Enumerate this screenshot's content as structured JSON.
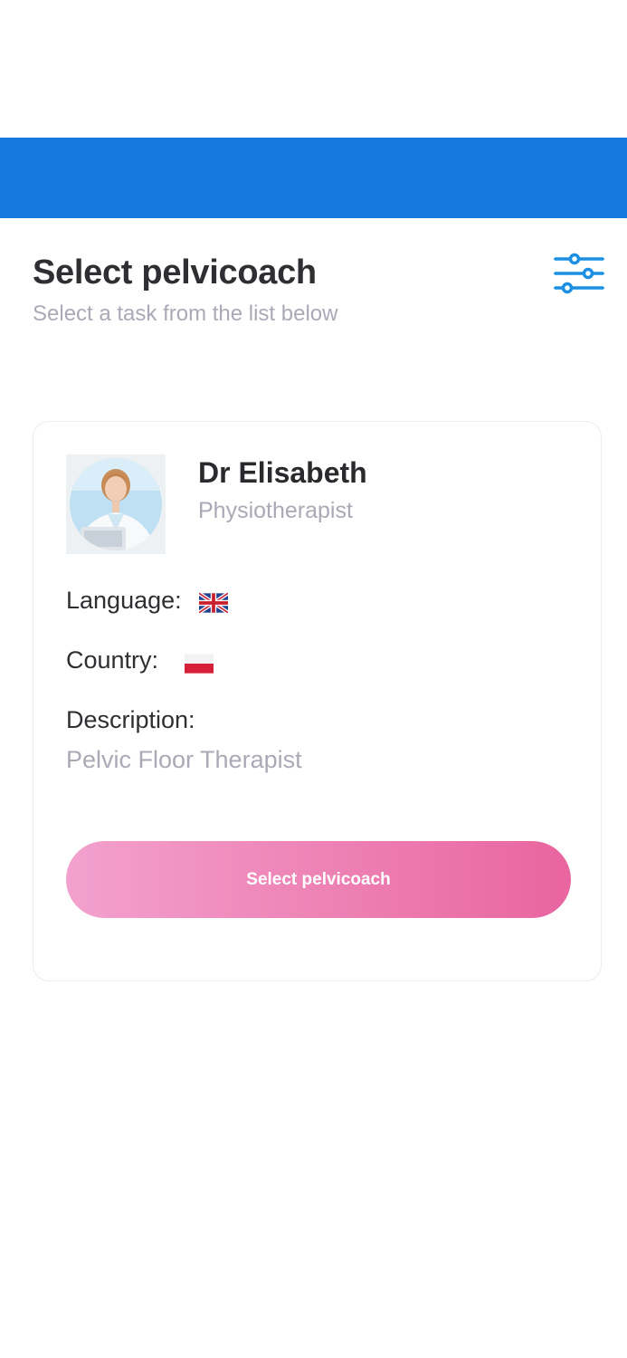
{
  "header": {
    "title": "Select pelvicoach",
    "subtitle": "Select a task from the list below",
    "filter_icon": "sliders-icon",
    "topbar_color": "#1479e1"
  },
  "coach_card": {
    "name": "Dr Elisabeth",
    "role": "Physiotherapist",
    "avatar_icon": "doctor-avatar",
    "language_label": "Language:",
    "language_flag": "uk-flag-icon",
    "country_label": "Country:",
    "country_flag": "poland-flag-icon",
    "description_label": "Description:",
    "description_value": "Pelvic Floor Therapist",
    "select_button_label": "Select pelvicoach"
  },
  "colors": {
    "accent_blue": "#1479e1",
    "button_pink_start": "#f3a1ce",
    "button_pink_end": "#e9659f",
    "muted_text": "#a9aab6",
    "dark_text": "#2f2f33"
  }
}
